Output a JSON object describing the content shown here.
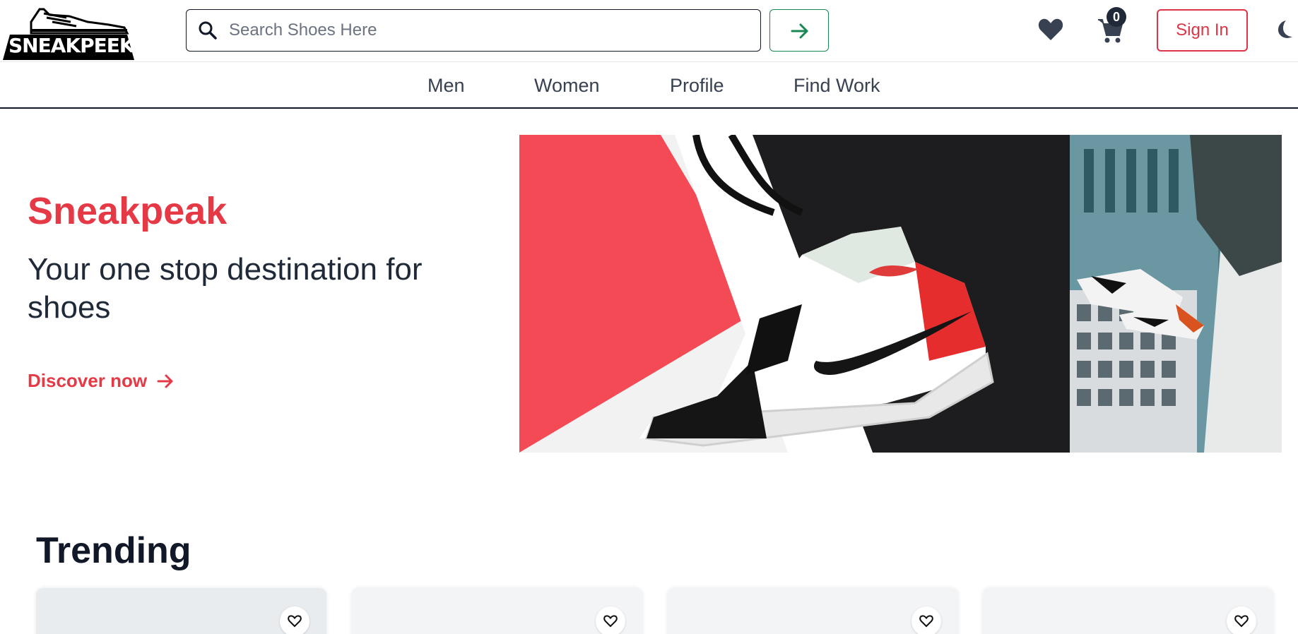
{
  "brand": {
    "logo_text": "SNEAKPEEK"
  },
  "search": {
    "placeholder": "Search Shoes Here",
    "value": ""
  },
  "header": {
    "cart_count": "0",
    "sign_in_label": "Sign In",
    "icons": {
      "search": "search-icon",
      "submit": "arrow-right-icon",
      "wishlist": "heart-icon",
      "cart": "cart-icon",
      "theme": "moon-icon"
    }
  },
  "nav": {
    "items": [
      {
        "label": "Men"
      },
      {
        "label": "Women"
      },
      {
        "label": "Profile"
      },
      {
        "label": "Find Work"
      }
    ]
  },
  "hero": {
    "title": "Sneakpeak",
    "subtitle": "Your one stop destination for shoes",
    "cta_label": "Discover now"
  },
  "trending": {
    "title": "Trending",
    "cards": [
      {
        "icon": "heart-outline-icon"
      },
      {
        "icon": "heart-outline-icon"
      },
      {
        "icon": "heart-outline-icon"
      },
      {
        "icon": "heart-outline-icon"
      }
    ]
  },
  "colors": {
    "accent": "#e63946",
    "go_button": "#198754",
    "sign_in": "#dc3545",
    "text": "#1f2937"
  }
}
